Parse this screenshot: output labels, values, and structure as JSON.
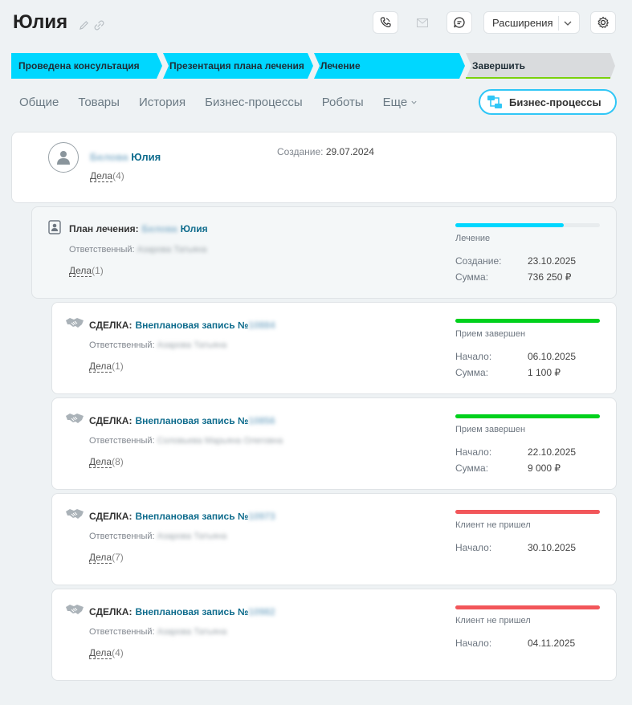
{
  "header": {
    "title": "Юлия",
    "extensions_label": "Расширения",
    "icons": [
      "pencil-icon",
      "link-icon",
      "phone-icon",
      "mail-icon",
      "chat-icon",
      "chevron-down-icon",
      "gear-icon"
    ]
  },
  "stages": [
    {
      "label": "Проведена консультация"
    },
    {
      "label": "Презентация плана лечения"
    },
    {
      "label": "Лечение"
    },
    {
      "label": "Завершить"
    }
  ],
  "tabs": [
    "Общие",
    "Товары",
    "История",
    "Бизнес-процессы",
    "Роботы",
    "Еще"
  ],
  "bp_button": "Бизнес-процессы",
  "colors": {
    "accent": "#00d7ff",
    "green": "#00d11c",
    "red": "#f2565a",
    "link": "#0f6c8d"
  },
  "contact": {
    "surname": "Белова",
    "name": "Юлия",
    "deals_label": "Дела",
    "deals_count": "(4)",
    "created_label": "Создание:",
    "created_value": "29.07.2024"
  },
  "plan": {
    "title_label": "План лечения:",
    "surname": "Белова",
    "name": "Юлия",
    "responsible_label": "Ответственный:",
    "responsible_value": "Азарова Татьяна",
    "deals_label": "Дела",
    "deals_count": "(1)",
    "progress": 0.75,
    "status": "Лечение",
    "created_label": "Создание:",
    "created_value": "23.10.2025",
    "sum_label": "Сумма:",
    "sum_value": "736 250 ₽"
  },
  "deals": [
    {
      "prefix": "СДЕЛКА:",
      "title": "Внеплановая запись №",
      "number": "10884",
      "responsible_label": "Ответственный:",
      "responsible_value": "Азарова Татьяна",
      "deals_label": "Дела",
      "deals_count": "(1)",
      "status": "Прием завершен",
      "bar_color": "#00d11c",
      "start_label": "Начало:",
      "start_value": "06.10.2025",
      "sum_label": "Сумма:",
      "sum_value": "1 100 ₽"
    },
    {
      "prefix": "СДЕЛКА:",
      "title": "Внеплановая запись №",
      "number": "10856",
      "responsible_label": "Ответственный:",
      "responsible_value": "Соловьева Марьяна Олеговна",
      "deals_label": "Дела",
      "deals_count": "(8)",
      "status": "Прием завершен",
      "bar_color": "#00d11c",
      "start_label": "Начало:",
      "start_value": "22.10.2025",
      "sum_label": "Сумма:",
      "sum_value": "9 000 ₽"
    },
    {
      "prefix": "СДЕЛКА:",
      "title": "Внеплановая запись №",
      "number": "10973",
      "responsible_label": "Ответственный:",
      "responsible_value": "Азарова Татьяна",
      "deals_label": "Дела",
      "deals_count": "(7)",
      "status": "Клиент не пришел",
      "bar_color": "#f2565a",
      "start_label": "Начало:",
      "start_value": "30.10.2025"
    },
    {
      "prefix": "СДЕЛКА:",
      "title": "Внеплановая запись №",
      "number": "10982",
      "responsible_label": "Ответственный:",
      "responsible_value": "Азарова Татьяна",
      "deals_label": "Дела",
      "deals_count": "(4)",
      "status": "Клиент не пришел",
      "bar_color": "#f2565a",
      "start_label": "Начало:",
      "start_value": "04.11.2025"
    }
  ]
}
